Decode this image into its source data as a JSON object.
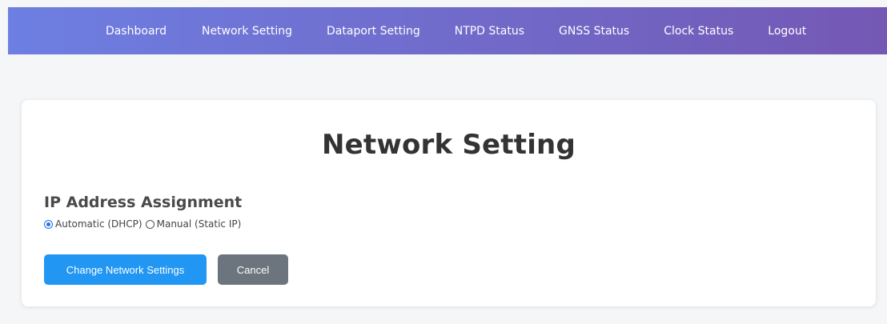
{
  "nav": {
    "items": [
      {
        "label": "Dashboard"
      },
      {
        "label": "Network Setting"
      },
      {
        "label": "Dataport Setting"
      },
      {
        "label": "NTPD Status"
      },
      {
        "label": "GNSS Status"
      },
      {
        "label": "Clock Status"
      },
      {
        "label": "Logout"
      }
    ],
    "gradient_start": "#6d7fe2",
    "gradient_end": "#7458b4"
  },
  "main": {
    "title": "Network Setting",
    "ip_assignment": {
      "heading": "IP Address Assignment",
      "options": [
        {
          "label": "Automatic (DHCP)",
          "selected": true
        },
        {
          "label": "Manual (Static IP)",
          "selected": false
        }
      ]
    },
    "buttons": {
      "change_label": "Change Network Settings",
      "cancel_label": "Cancel"
    }
  },
  "colors": {
    "primary_button": "#2196f3",
    "secondary_button": "#6c757d",
    "page_background": "#f5f6f8"
  }
}
